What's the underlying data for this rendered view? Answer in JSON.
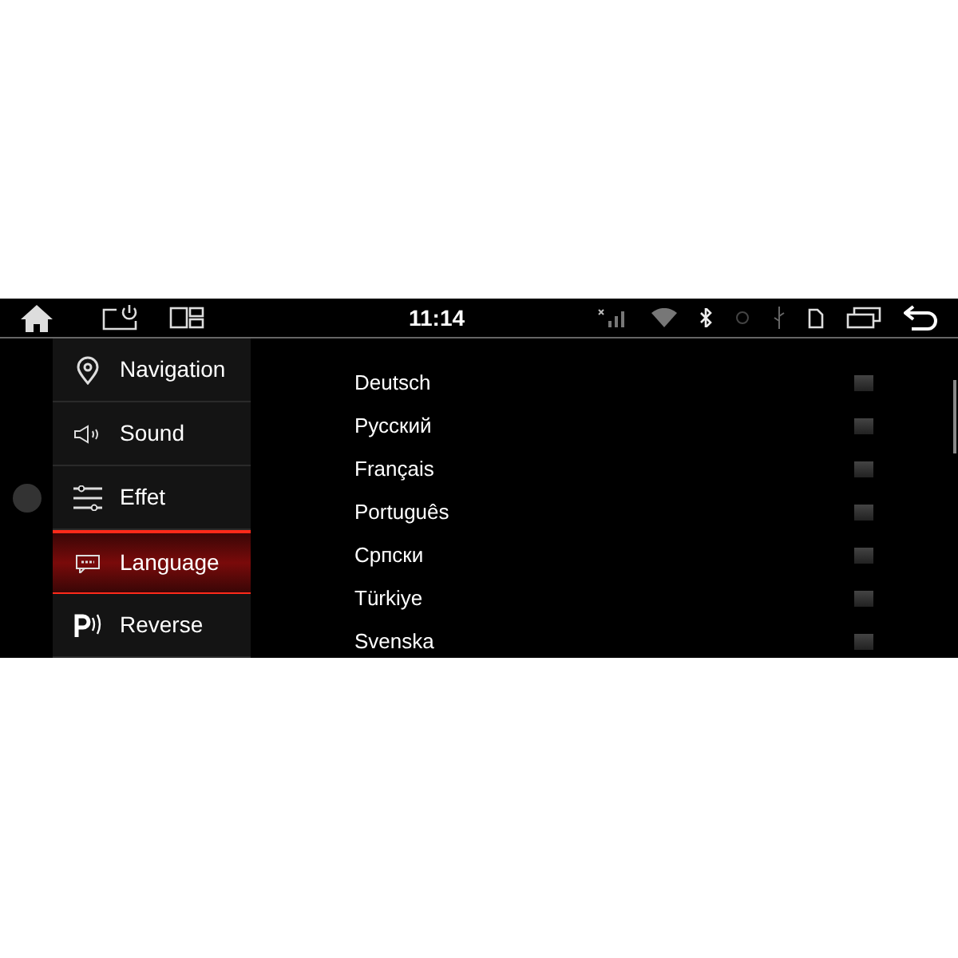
{
  "status_bar": {
    "time": "11:14"
  },
  "menu": [
    {
      "label": "Navigation",
      "kind": "pin",
      "selected": false
    },
    {
      "label": "Sound",
      "kind": "speaker",
      "selected": false
    },
    {
      "label": "Effet",
      "kind": "sliders",
      "selected": false
    },
    {
      "label": "Language",
      "kind": "abc",
      "selected": true
    },
    {
      "label": "Reverse",
      "kind": "parking",
      "selected": false
    }
  ],
  "languages": [
    {
      "label": "Deutsch",
      "checked": false
    },
    {
      "label": "Русский",
      "checked": false
    },
    {
      "label": "Français",
      "checked": false
    },
    {
      "label": "Português",
      "checked": false
    },
    {
      "label": "Српски",
      "checked": false
    },
    {
      "label": "Türkiye",
      "checked": false
    },
    {
      "label": "Svenska",
      "checked": false
    }
  ]
}
